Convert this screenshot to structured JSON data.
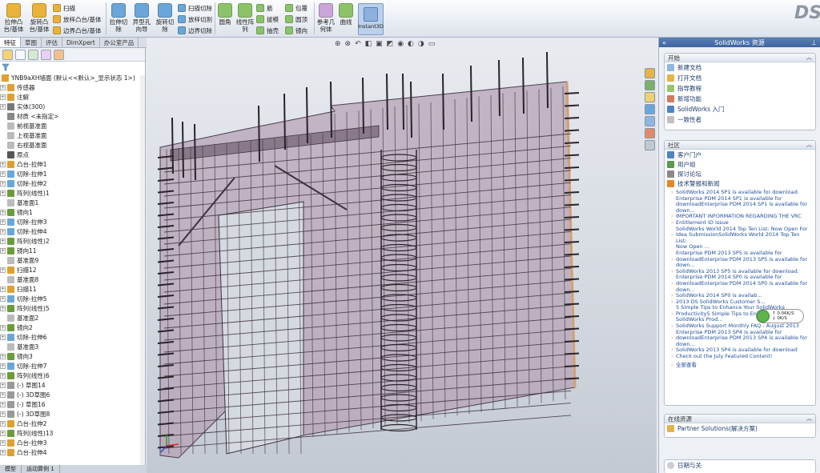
{
  "ribbon": {
    "big_buttons": [
      {
        "label": "拉伸凸\n台/基体",
        "icon": "extrude-boss-icon",
        "color": "#e9b23a"
      },
      {
        "label": "旋转凸\n台/基体",
        "icon": "revolve-boss-icon",
        "color": "#e9b23a"
      },
      {
        "label": "拉伸切\n除",
        "icon": "extrude-cut-icon",
        "color": "#6aa7d8"
      },
      {
        "label": "异型孔\n向导",
        "icon": "hole-wizard-icon",
        "color": "#6aa7d8"
      },
      {
        "label": "旋转切\n除",
        "icon": "revolve-cut-icon",
        "color": "#6aa7d8"
      },
      {
        "label": "圆角",
        "icon": "fillet-icon",
        "color": "#8cc36a"
      },
      {
        "label": "线性阵\n列",
        "icon": "linear-pattern-icon",
        "color": "#8cc36a"
      },
      {
        "label": "参考几\n何体",
        "icon": "reference-geometry-icon",
        "color": "#c9a5d8"
      },
      {
        "label": "曲线",
        "icon": "curves-icon",
        "color": "#8cc36a"
      }
    ],
    "small_buttons": [
      {
        "label": "扫描",
        "color": "#e9b23a"
      },
      {
        "label": "放样凸台/基体",
        "color": "#e9b23a"
      },
      {
        "label": "边界凸台/基体",
        "color": "#e9b23a"
      },
      {
        "label": "扫描切除",
        "color": "#6aa7d8"
      },
      {
        "label": "放样切割",
        "color": "#6aa7d8"
      },
      {
        "label": "边界切除",
        "color": "#6aa7d8"
      },
      {
        "label": "筋",
        "color": "#8cc36a"
      },
      {
        "label": "拔模",
        "color": "#8cc36a"
      },
      {
        "label": "抽壳",
        "color": "#8cc36a"
      },
      {
        "label": "包覆",
        "color": "#8cc36a"
      },
      {
        "label": "圆顶",
        "color": "#8cc36a"
      },
      {
        "label": "镜向",
        "color": "#8cc36a"
      }
    ],
    "instant3d_label": "Instant3D",
    "logo": "DS"
  },
  "tabs": [
    "特征",
    "草图",
    "评估",
    "DimXpert",
    "办公室产品"
  ],
  "tree": {
    "root": "YNB9aXH墙面 (默认<<默认>_显示状态 1>)",
    "items": [
      {
        "label": "传感器",
        "color": "#e0a030",
        "plus": true
      },
      {
        "label": "注解",
        "color": "#e0a030",
        "plus": true
      },
      {
        "label": "实体(300)",
        "color": "#777",
        "plus": true
      },
      {
        "label": "材质 <未指定>",
        "color": "#888",
        "plus": false
      },
      {
        "label": "前视基准面",
        "color": "#bbb",
        "plus": false
      },
      {
        "label": "上视基准面",
        "color": "#bbb",
        "plus": false
      },
      {
        "label": "右视基准面",
        "color": "#bbb",
        "plus": false
      },
      {
        "label": "原点",
        "color": "#555",
        "plus": false
      },
      {
        "label": "凸台-拉伸1",
        "color": "#e0a030",
        "plus": true
      },
      {
        "label": "切除-拉伸1",
        "color": "#6aa7d8",
        "plus": true
      },
      {
        "label": "切除-拉伸2",
        "color": "#6aa7d8",
        "plus": true
      },
      {
        "label": "阵列(线性)1",
        "color": "#6b9c3a",
        "plus": true
      },
      {
        "label": "基准面1",
        "color": "#bbb",
        "plus": false
      },
      {
        "label": "镜向1",
        "color": "#6b9c3a",
        "plus": true
      },
      {
        "label": "切除-拉伸3",
        "color": "#6aa7d8",
        "plus": true
      },
      {
        "label": "切除-拉伸4",
        "color": "#6aa7d8",
        "plus": true
      },
      {
        "label": "阵列(线性)2",
        "color": "#6b9c3a",
        "plus": true
      },
      {
        "label": "镜向11",
        "color": "#6b9c3a",
        "plus": true
      },
      {
        "label": "基准面9",
        "color": "#bbb",
        "plus": false
      },
      {
        "label": "扫描12",
        "color": "#e0a030",
        "plus": true
      },
      {
        "label": "基准面8",
        "color": "#bbb",
        "plus": false
      },
      {
        "label": "扫描11",
        "color": "#e0a030",
        "plus": true
      },
      {
        "label": "切除-拉伸5",
        "color": "#6aa7d8",
        "plus": true
      },
      {
        "label": "阵列(线性)5",
        "color": "#6b9c3a",
        "plus": true
      },
      {
        "label": "基准面2",
        "color": "#bbb",
        "plus": false
      },
      {
        "label": "镜向2",
        "color": "#6b9c3a",
        "plus": true
      },
      {
        "label": "切除-拉伸6",
        "color": "#6aa7d8",
        "plus": true
      },
      {
        "label": "基准面3",
        "color": "#bbb",
        "plus": false
      },
      {
        "label": "镜向3",
        "color": "#6b9c3a",
        "plus": true
      },
      {
        "label": "切除-拉伸7",
        "color": "#6aa7d8",
        "plus": true
      },
      {
        "label": "阵列(线性)6",
        "color": "#6b9c3a",
        "plus": true
      },
      {
        "label": "(-) 草图14",
        "color": "#999",
        "plus": true
      },
      {
        "label": "(-) 3D草图6",
        "color": "#999",
        "plus": true
      },
      {
        "label": "(-) 草图16",
        "color": "#999",
        "plus": true
      },
      {
        "label": "(-) 3D草图8",
        "color": "#999",
        "plus": true
      },
      {
        "label": "凸台-拉伸2",
        "color": "#e0a030",
        "plus": true
      },
      {
        "label": "阵列(线性)13",
        "color": "#6b9c3a",
        "plus": true
      },
      {
        "label": "凸台-拉伸3",
        "color": "#e0a030",
        "plus": true
      },
      {
        "label": "凸台-拉伸4",
        "color": "#e0a030",
        "plus": true
      }
    ]
  },
  "bottom_tabs": [
    "模型",
    "运动算例 1"
  ],
  "task_pane": {
    "title": "SolidWorks 资源",
    "start": {
      "title": "开始",
      "items": [
        "新建文档",
        "打开文档",
        "指导教程",
        "新增功能",
        "SolidWorks 入门",
        "一致性者"
      ]
    },
    "community": {
      "title": "社区",
      "items": [
        "客户门户",
        "用户组",
        "探讨论坛",
        "技术警报和新闻"
      ],
      "news": [
        {
          "text": "SolidWorks 2014 SP1 is available for download.",
          "bullet": true
        },
        {
          "text": "Enterprise PDM 2014 SP1 is available for",
          "bullet": false
        },
        {
          "text": "downloadEnterprise PDM 2014 SP1 is available for",
          "bullet": false
        },
        {
          "text": "down...",
          "bullet": false
        },
        {
          "text": "IMPORTANT INFORMATION REGARDING THE VRC",
          "bullet": true
        },
        {
          "text": "Entitlement ID Issue",
          "bullet": true
        },
        {
          "text": "SolidWorks World 2014 Top Ten List: Now Open For",
          "bullet": false
        },
        {
          "text": "Idea SubmissionSolidWorks World 2014 Top Ten List:",
          "bullet": true
        },
        {
          "text": "Now Open ...",
          "bullet": false
        },
        {
          "text": "Enterprise PDM 2013 SP5 is available for",
          "bullet": false
        },
        {
          "text": "downloadEnterprise PDM 2013 SP5 is available for",
          "bullet": true
        },
        {
          "text": "down...",
          "bullet": false
        },
        {
          "text": "SolidWorks 2013 SP5 is available for download.",
          "bullet": true
        },
        {
          "text": "Enterprise PDM 2014 SP0 is available for",
          "bullet": false
        },
        {
          "text": "downloadEnterprise PDM 2014 SP0 is available for",
          "bullet": true
        },
        {
          "text": "down...",
          "bullet": false
        },
        {
          "text": "SolidWorks 2014 SP0 is availab...",
          "bullet": true
        },
        {
          "text": "2013 DS SolidWorks Customer S...",
          "bullet": true
        },
        {
          "text": "5 Simple Tips to Enhance Your SolidWorks",
          "bullet": false
        },
        {
          "text": "Productivity5 Simple Tips to Enhance Your",
          "bullet": true
        },
        {
          "text": "SolidWorks Prod...",
          "bullet": false
        },
        {
          "text": "SolidWorks Support Monthly FAQ - August 2013",
          "bullet": true
        },
        {
          "text": "Enterprise PDM 2013 SP4 is available for",
          "bullet": false
        },
        {
          "text": "downloadEnterprise PDM 2013 SP4 is available for",
          "bullet": true
        },
        {
          "text": "down...",
          "bullet": false
        },
        {
          "text": "SolidWorks 2013 SP4 is available for download",
          "bullet": true
        },
        {
          "text": "Check out the July Featured Content!",
          "bullet": true
        }
      ],
      "all_link": "全部查看"
    },
    "online": {
      "title": "在线资源",
      "items": [
        "Partner Solutions(解决方案)"
      ]
    },
    "bottom_item": "日期与关"
  },
  "download_widget": {
    "up": "0.06K/S",
    "down": "0K/S"
  }
}
